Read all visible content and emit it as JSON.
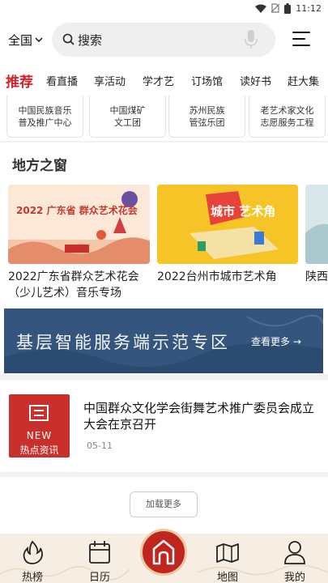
{
  "status_bar": {
    "time": "11:12"
  },
  "header": {
    "region_label": "全国",
    "search_placeholder": "搜索"
  },
  "tabs": [
    {
      "label": "推荐",
      "active": true
    },
    {
      "label": "看直播"
    },
    {
      "label": "享活动"
    },
    {
      "label": "学才艺"
    },
    {
      "label": "订场馆"
    },
    {
      "label": "读好书"
    },
    {
      "label": "赶大集"
    }
  ],
  "partners": [
    {
      "line1": "中国民族音乐",
      "line2": "普及推广中心"
    },
    {
      "line1": "中国煤矿",
      "line2": "文工团"
    },
    {
      "line1": "苏州民族",
      "line2": "管弦乐团"
    },
    {
      "line1": "老艺术家文化",
      "line2": "志愿服务工程"
    }
  ],
  "local_section": {
    "title": "地方之窗",
    "cards": [
      {
        "caption": "2022广东省群众艺术花会（少儿艺术）音乐专场",
        "image_text": "2022 广东省 群众艺术花会"
      },
      {
        "caption": "2022台州市城市艺术角",
        "image_text": "城市 艺术角"
      },
      {
        "caption": "陕西"
      }
    ],
    "banner": {
      "title": "基层智能服务端示范专区",
      "more": "查看更多 →"
    }
  },
  "news": [
    {
      "thumb_badge": "NEW",
      "thumb_tag": "热点资讯",
      "title": "中国群众文化学会街舞艺术推广委员会成立大会在京召开",
      "date": "05-11"
    }
  ],
  "load_more": "加载更多",
  "bottom_nav": [
    {
      "label": "热榜",
      "icon": "flame-icon"
    },
    {
      "label": "日历",
      "icon": "calendar-icon"
    },
    {
      "label": "",
      "icon": "home-icon"
    },
    {
      "label": "地图",
      "icon": "map-icon"
    },
    {
      "label": "我的",
      "icon": "user-icon"
    }
  ],
  "colors": {
    "accent": "#d3222a",
    "banner": "#33557d",
    "news_thumb": "#c9302c",
    "nav_bg": "#f7eee3"
  }
}
